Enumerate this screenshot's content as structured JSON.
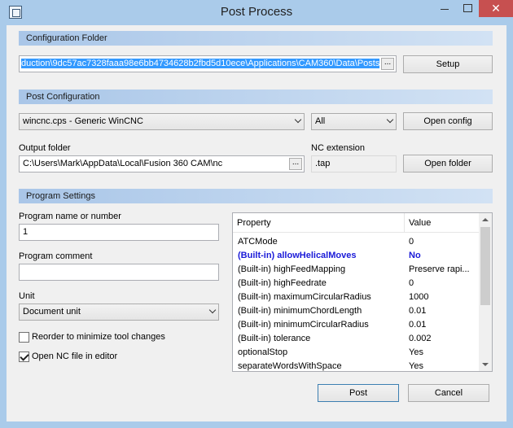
{
  "window": {
    "title": "Post Process"
  },
  "config_folder": {
    "header": "Configuration Folder",
    "path": "duction\\9dc57ac7328faaa98e6bb4734628b2fbd5d10ece\\Applications\\CAM360\\Data\\Posts",
    "browse": "...",
    "setup_label": "Setup"
  },
  "post_config": {
    "header": "Post Configuration",
    "post": "wincnc.cps - Generic WinCNC",
    "filter": "All",
    "open_config_label": "Open config",
    "output_folder_label": "Output folder",
    "output_folder": "C:\\Users\\Mark\\AppData\\Local\\Fusion 360 CAM\\nc",
    "browse": "...",
    "nc_extension_label": "NC extension",
    "nc_extension": ".tap",
    "open_folder_label": "Open folder"
  },
  "program_settings": {
    "header": "Program Settings",
    "name_label": "Program name or number",
    "name_value": "1",
    "comment_label": "Program comment",
    "comment_value": "",
    "unit_label": "Unit",
    "unit_value": "Document unit",
    "reorder_label": "Reorder to minimize tool changes",
    "reorder_checked": false,
    "open_nc_label": "Open NC file in editor",
    "open_nc_checked": true
  },
  "properties": {
    "col_property": "Property",
    "col_value": "Value",
    "rows": [
      {
        "name": "ATCMode",
        "value": "0"
      },
      {
        "name": "(Built-in) allowHelicalMoves",
        "value": "No"
      },
      {
        "name": "(Built-in) highFeedMapping",
        "value": "Preserve rapi..."
      },
      {
        "name": "(Built-in) highFeedrate",
        "value": "0"
      },
      {
        "name": "(Built-in) maximumCircularRadius",
        "value": "1000"
      },
      {
        "name": "(Built-in) minimumChordLength",
        "value": "0.01"
      },
      {
        "name": "(Built-in) minimumCircularRadius",
        "value": "0.01"
      },
      {
        "name": "(Built-in) tolerance",
        "value": "0.002"
      },
      {
        "name": "optionalStop",
        "value": "Yes"
      },
      {
        "name": "separateWordsWithSpace",
        "value": "Yes"
      }
    ]
  },
  "actions": {
    "post_label": "Post",
    "cancel_label": "Cancel"
  }
}
